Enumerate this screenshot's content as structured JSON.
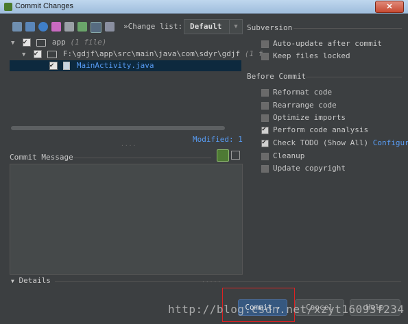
{
  "window": {
    "title": "Commit Changes",
    "close_label": "✕"
  },
  "toolbar": {
    "change_list_label": "»Change list:",
    "change_list_value": "Default"
  },
  "tree": {
    "root": {
      "name": "app",
      "count": "(1 file)"
    },
    "folder": {
      "path": "F:\\gdjf\\app\\src\\main\\java\\com\\sdyr\\gdjf",
      "count": "(1 f"
    },
    "file": {
      "name": "MainActivity.java"
    }
  },
  "modified_label": "Modified: 1",
  "commit_message": {
    "label": "Commit Message",
    "text": ""
  },
  "subversion": {
    "title": "Subversion",
    "options": [
      {
        "label": "Auto-update after commit",
        "checked": false
      },
      {
        "label": "Keep files locked",
        "checked": false
      }
    ]
  },
  "before_commit": {
    "title": "Before Commit",
    "options": [
      {
        "label": "Reformat code",
        "checked": false
      },
      {
        "label": "Rearrange code",
        "checked": false
      },
      {
        "label": "Optimize imports",
        "checked": false
      },
      {
        "label": "Perform code analysis",
        "checked": true
      },
      {
        "label": "Check TODO (Show All)",
        "checked": true,
        "link": "Configure"
      },
      {
        "label": "Cleanup",
        "checked": false
      },
      {
        "label": "Update copyright",
        "checked": false
      }
    ]
  },
  "details_label": "Details",
  "buttons": {
    "commit": "Commit",
    "cancel": "Cancel",
    "help": "Help"
  },
  "watermark": "http://blog.csdn.net/xzyt16093f234"
}
